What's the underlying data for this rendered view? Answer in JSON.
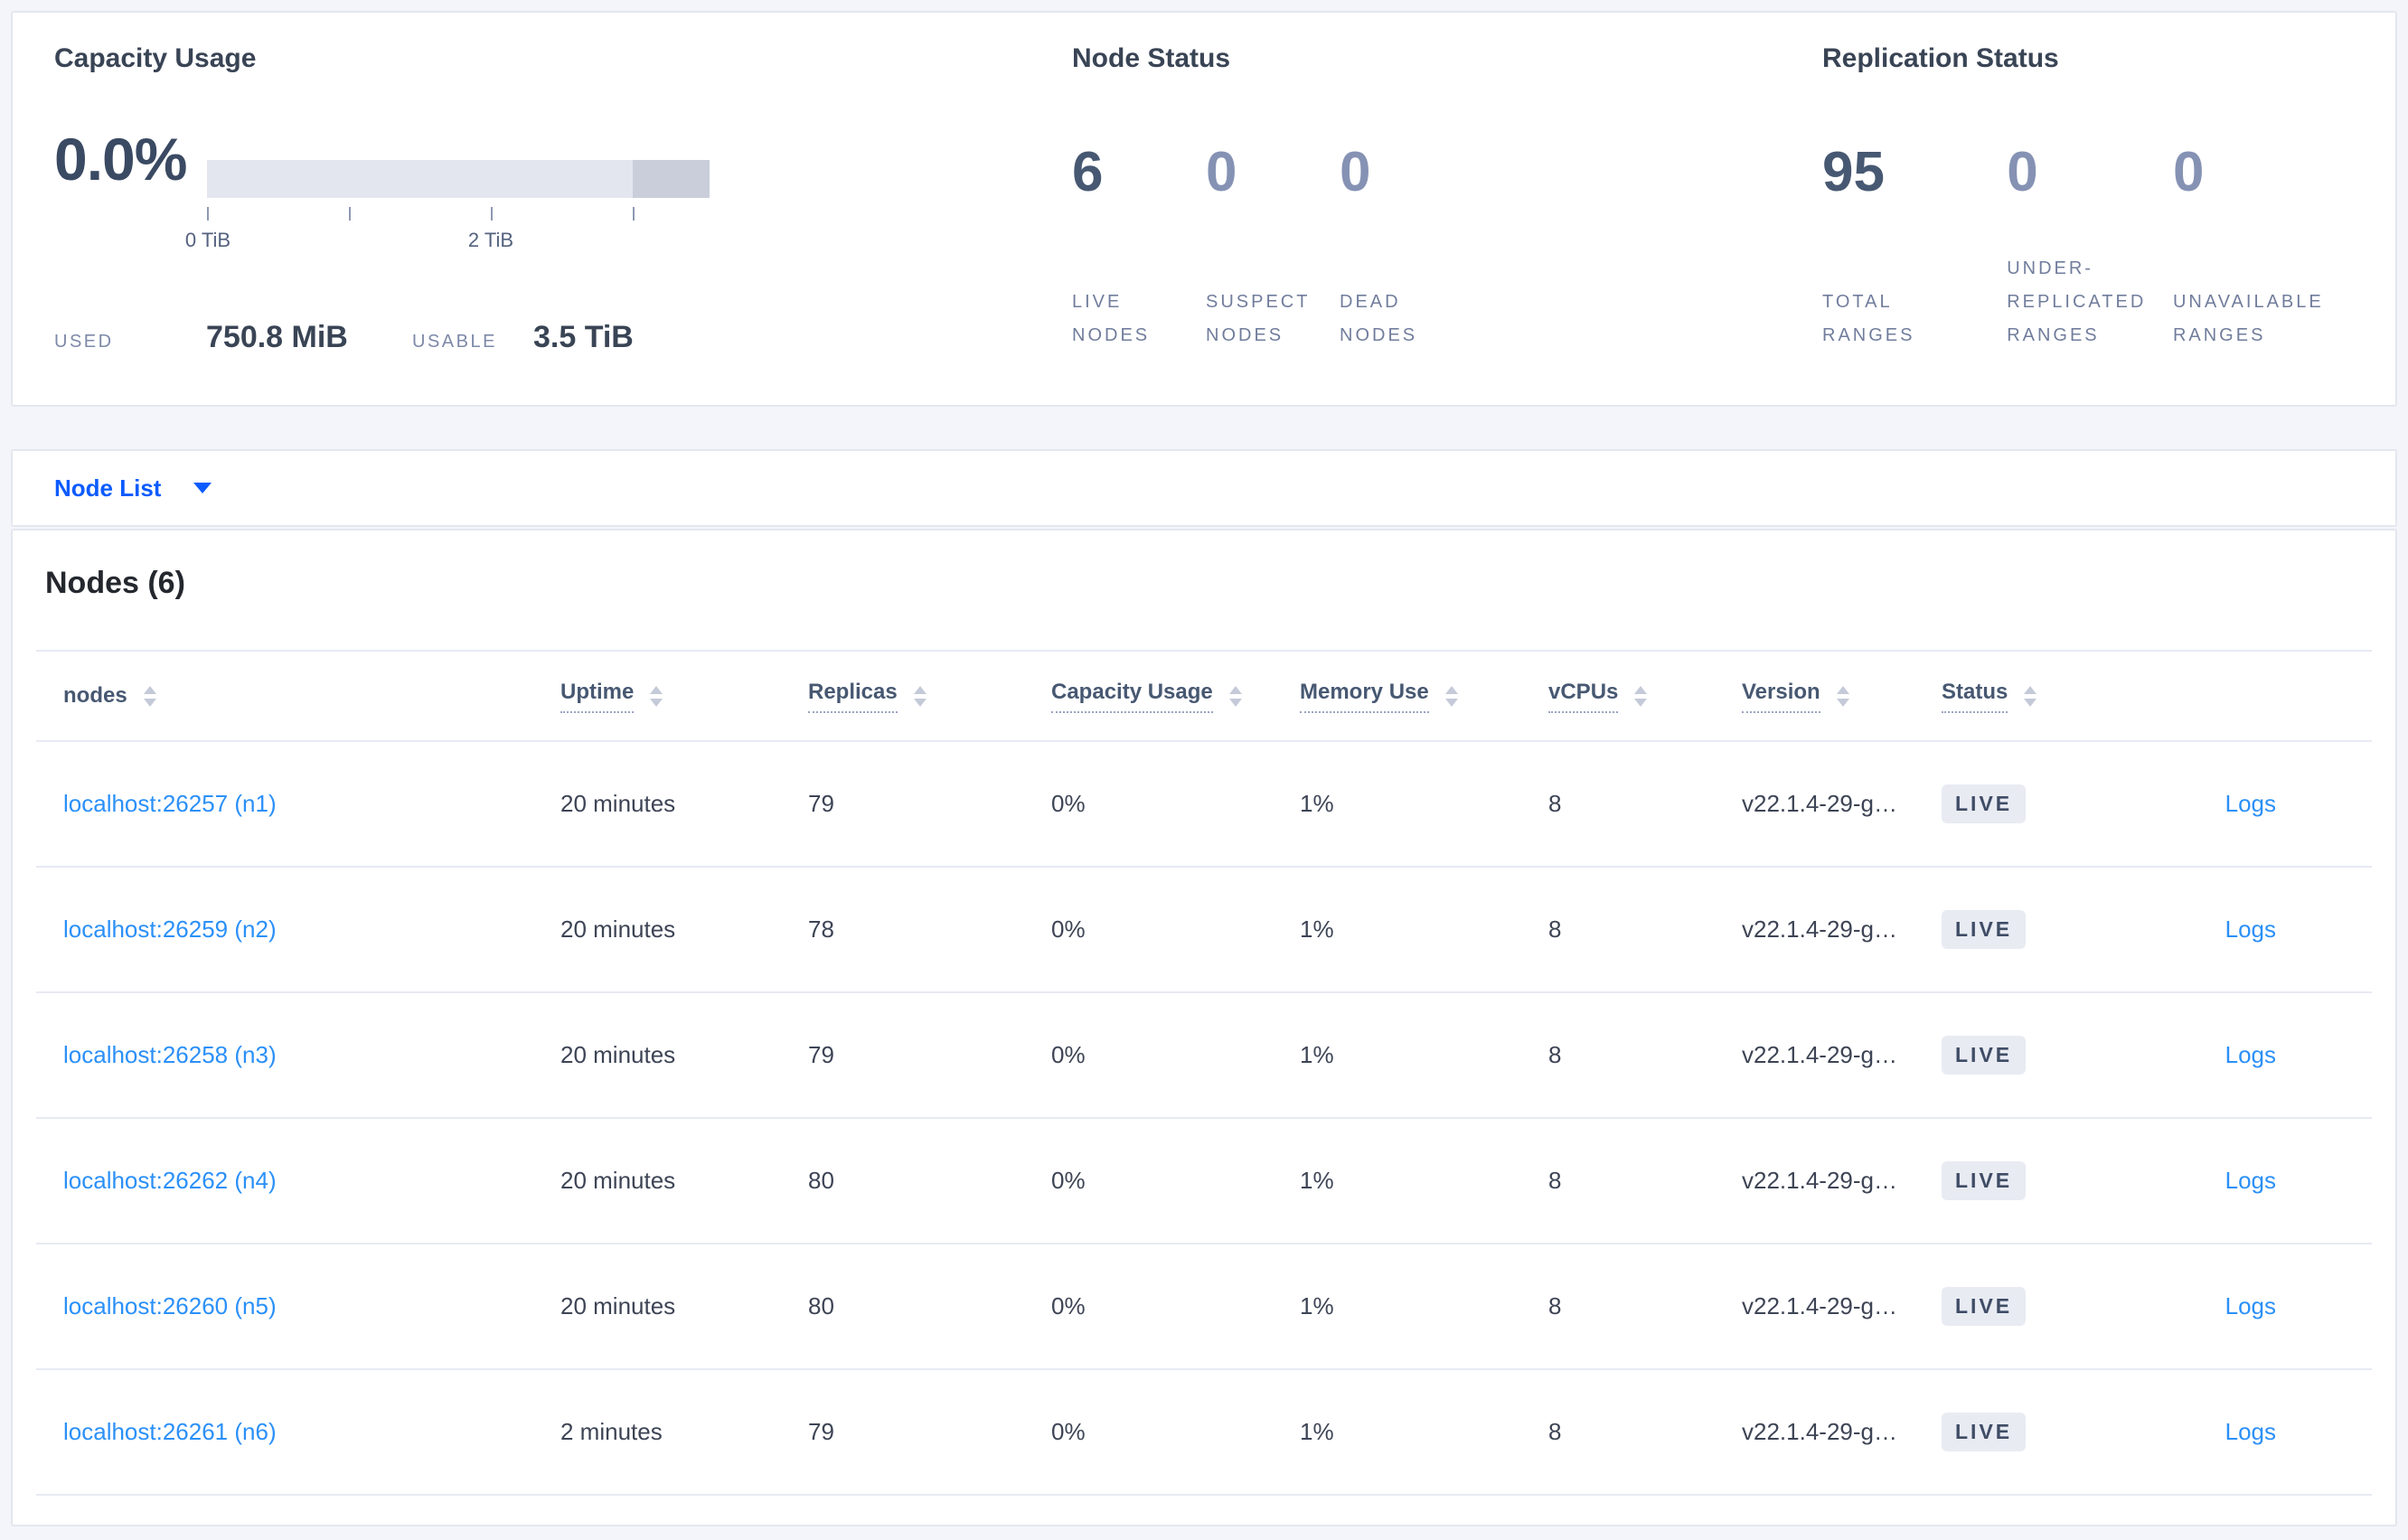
{
  "colors": {
    "accent_blue": "#0b5bff",
    "link_blue": "#2b90f8",
    "dark_slate": "#394455",
    "stat_muted": "#8592b4",
    "badge_bg": "#e8ebf2",
    "badge_text": "#3f4c66"
  },
  "summary": {
    "capacity": {
      "title": "Capacity Usage",
      "percent_used": "0.0%",
      "tick_labels": [
        "0 TiB",
        "2 TiB"
      ],
      "used_label": "USED",
      "used_value": "750.8 MiB",
      "usable_label": "USABLE",
      "usable_value": "3.5 TiB"
    },
    "node_status": {
      "title": "Node Status",
      "stats": [
        {
          "value": "6",
          "label": "LIVE NODES"
        },
        {
          "value": "0",
          "label": "SUSPECT NODES"
        },
        {
          "value": "0",
          "label": "DEAD NODES"
        }
      ]
    },
    "replication_status": {
      "title": "Replication Status",
      "stats": [
        {
          "value": "95",
          "label": "TOTAL RANGES"
        },
        {
          "value": "0",
          "label": "UNDER-REPLICATED RANGES"
        },
        {
          "value": "0",
          "label": "UNAVAILABLE RANGES"
        }
      ]
    }
  },
  "view_selector": {
    "selected": "Node List"
  },
  "nodes_table": {
    "title": "Nodes (6)",
    "columns": [
      "nodes",
      "Uptime",
      "Replicas",
      "Capacity Usage",
      "Memory Use",
      "vCPUs",
      "Version",
      "Status"
    ],
    "rows": [
      {
        "address": "localhost:26257 (n1)",
        "uptime": "20 minutes",
        "replicas": "79",
        "capacity_usage": "0%",
        "memory_use": "1%",
        "vcpus": "8",
        "version": "v22.1.4-29-g…",
        "status": "LIVE",
        "logs_label": "Logs"
      },
      {
        "address": "localhost:26259 (n2)",
        "uptime": "20 minutes",
        "replicas": "78",
        "capacity_usage": "0%",
        "memory_use": "1%",
        "vcpus": "8",
        "version": "v22.1.4-29-g…",
        "status": "LIVE",
        "logs_label": "Logs"
      },
      {
        "address": "localhost:26258 (n3)",
        "uptime": "20 minutes",
        "replicas": "79",
        "capacity_usage": "0%",
        "memory_use": "1%",
        "vcpus": "8",
        "version": "v22.1.4-29-g…",
        "status": "LIVE",
        "logs_label": "Logs"
      },
      {
        "address": "localhost:26262 (n4)",
        "uptime": "20 minutes",
        "replicas": "80",
        "capacity_usage": "0%",
        "memory_use": "1%",
        "vcpus": "8",
        "version": "v22.1.4-29-g…",
        "status": "LIVE",
        "logs_label": "Logs"
      },
      {
        "address": "localhost:26260 (n5)",
        "uptime": "20 minutes",
        "replicas": "80",
        "capacity_usage": "0%",
        "memory_use": "1%",
        "vcpus": "8",
        "version": "v22.1.4-29-g…",
        "status": "LIVE",
        "logs_label": "Logs"
      },
      {
        "address": "localhost:26261 (n6)",
        "uptime": "2 minutes",
        "replicas": "79",
        "capacity_usage": "0%",
        "memory_use": "1%",
        "vcpus": "8",
        "version": "v22.1.4-29-g…",
        "status": "LIVE",
        "logs_label": "Logs"
      }
    ]
  }
}
